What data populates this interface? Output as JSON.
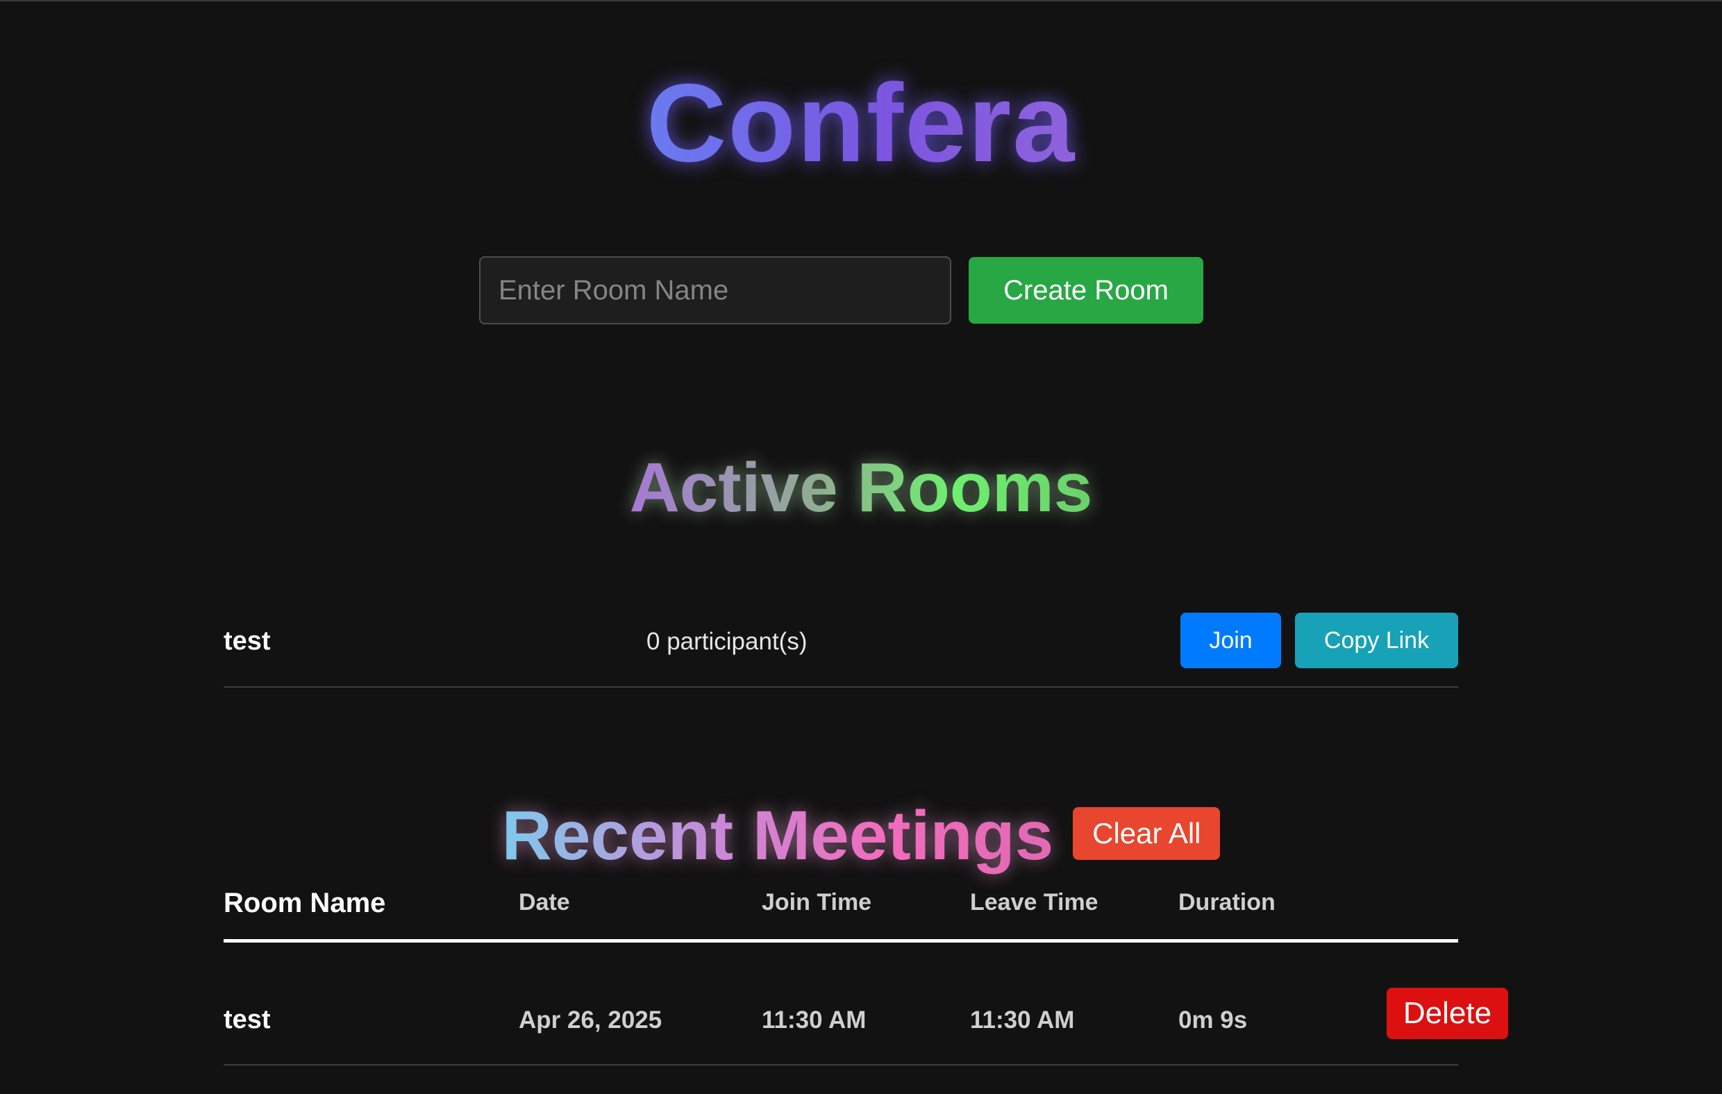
{
  "app": {
    "title": "Confera"
  },
  "create_room": {
    "input_placeholder": "Enter Room Name",
    "input_value": "",
    "button_label": "Create Room"
  },
  "active_rooms": {
    "title": "Active Rooms",
    "rooms": [
      {
        "name": "test",
        "participants": "0 participant(s)",
        "join_label": "Join",
        "copy_label": "Copy Link"
      }
    ]
  },
  "recent_meetings": {
    "title": "Recent Meetings",
    "clear_label": "Clear All",
    "columns": [
      "Room Name",
      "Date",
      "Join Time",
      "Leave Time",
      "Duration"
    ],
    "rows": [
      {
        "room_name": "test",
        "date": "Apr 26, 2025",
        "join_time": "11:30 AM",
        "leave_time": "11:30 AM",
        "duration": "0m 9s",
        "delete_label": "Delete"
      }
    ]
  },
  "colors": {
    "background": "#121212",
    "create_button": "#28a745",
    "join_button": "#007bff",
    "copy_button": "#17a2b8",
    "clear_button": "#e8462f",
    "delete_button": "#dc1010"
  }
}
